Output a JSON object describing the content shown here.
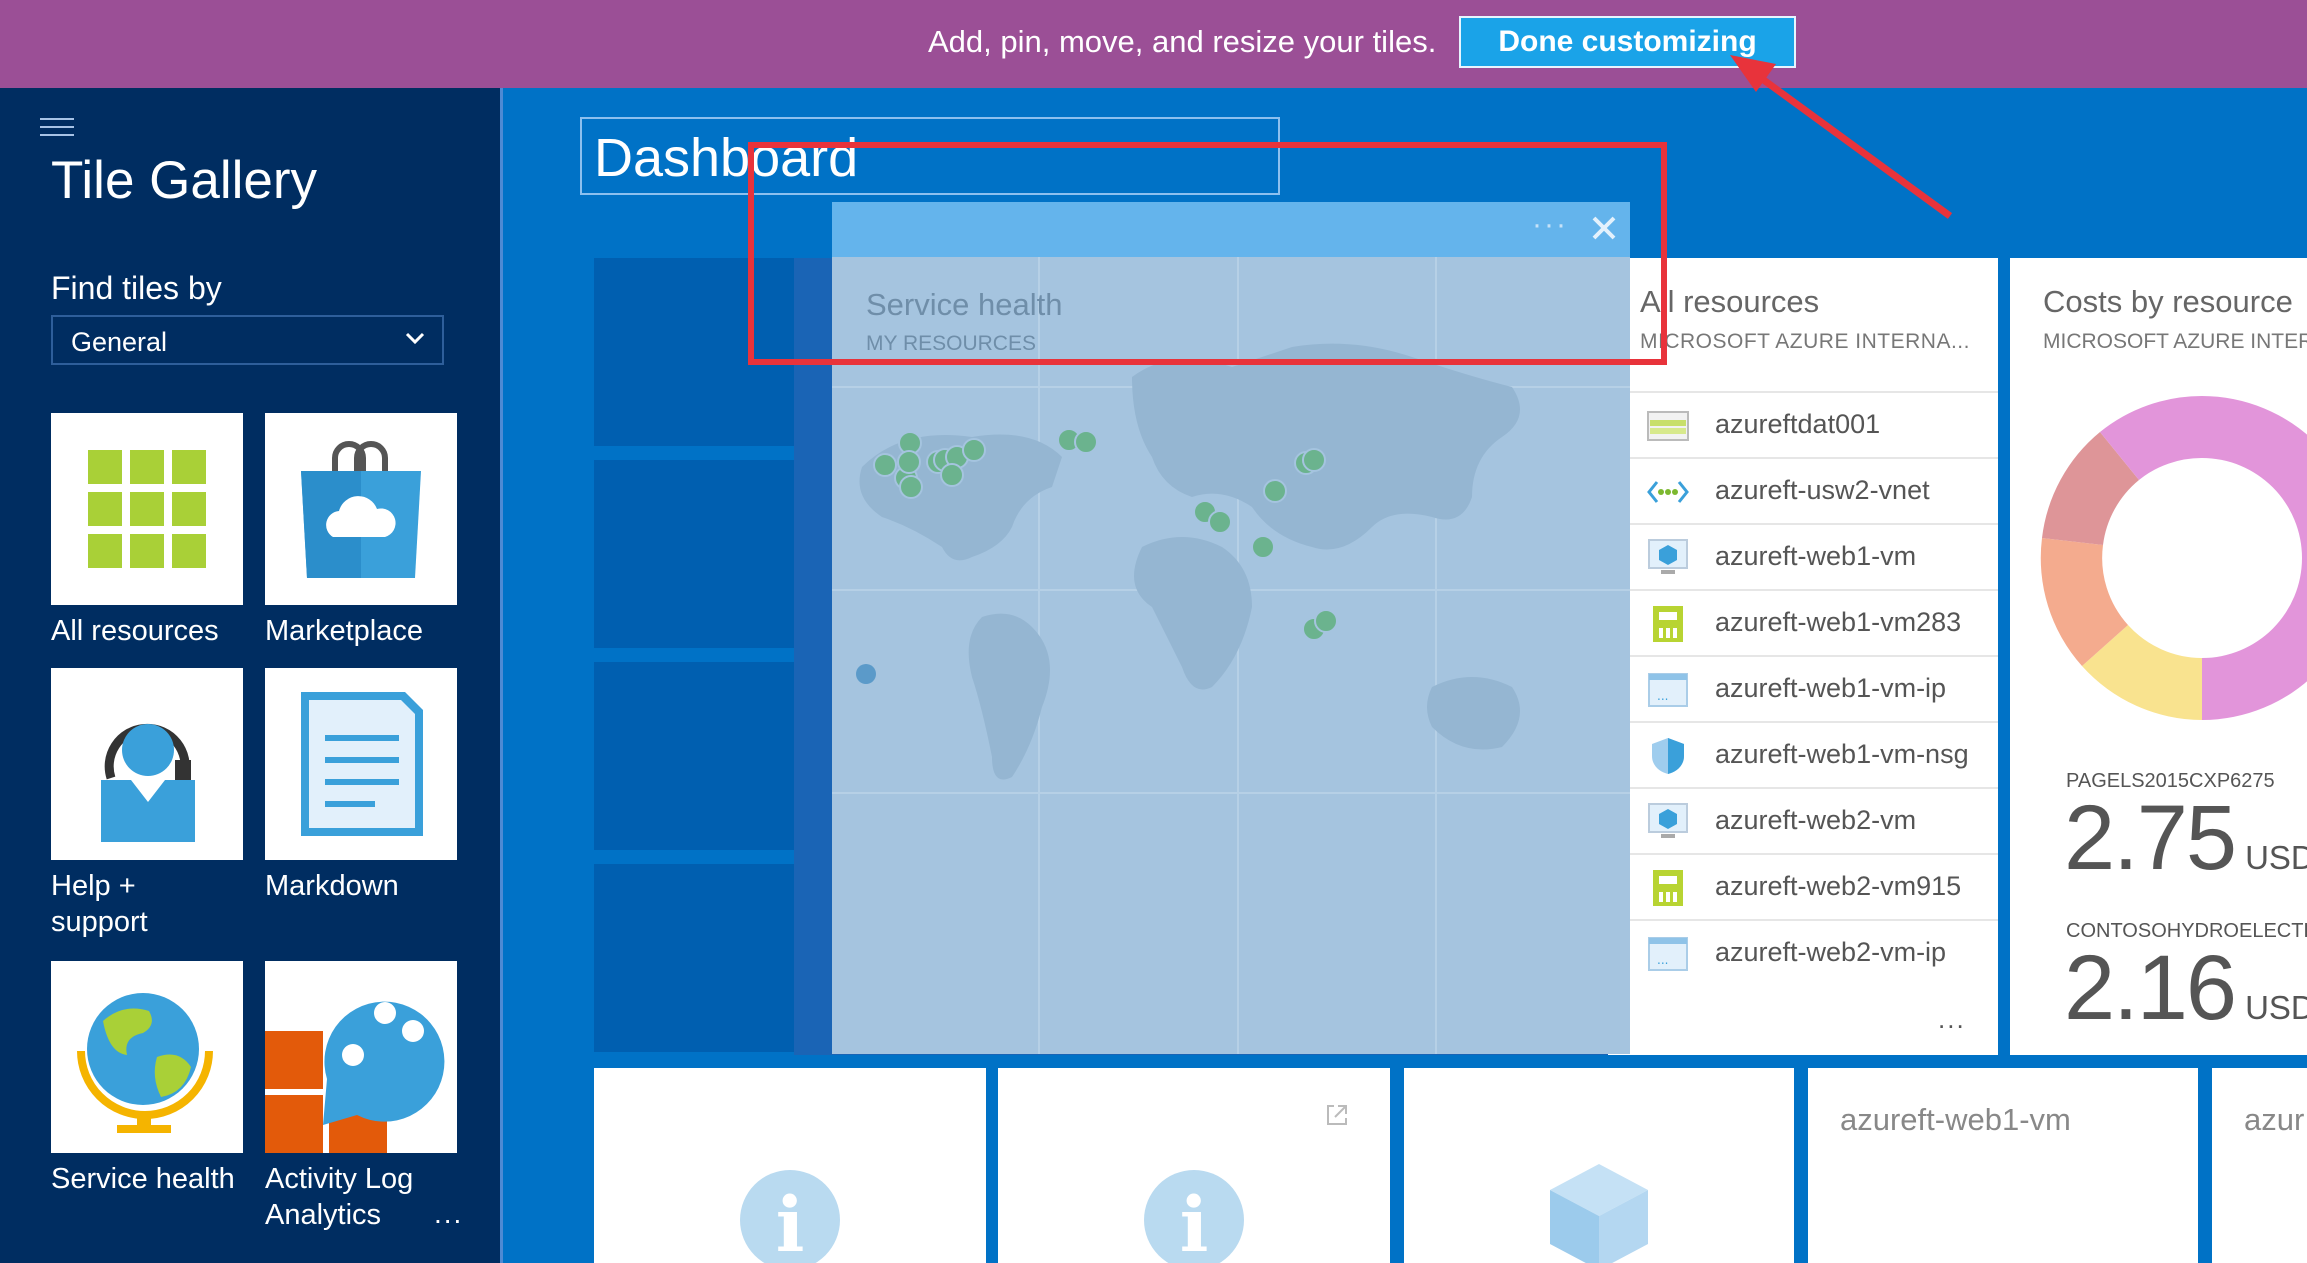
{
  "topbar": {
    "message": "Add, pin, move, and resize your tiles.",
    "done_label": "Done customizing",
    "bg_color": "#9b4f96",
    "button_color": "#1aa3e8"
  },
  "gallery": {
    "title": "Tile Gallery",
    "find_label": "Find tiles by",
    "filter_value": "General",
    "tiles": [
      {
        "label": "All resources",
        "icon": "grid-icon"
      },
      {
        "label": "Marketplace",
        "icon": "shopping-bag-icon"
      },
      {
        "label": "Help +\nsupport",
        "icon": "help-person-icon"
      },
      {
        "label": "Markdown",
        "icon": "document-icon"
      },
      {
        "label": "Service health",
        "icon": "globe-icon"
      },
      {
        "label": "Activity Log\nAnalytics",
        "icon": "activity-log-icon"
      }
    ],
    "more": "..."
  },
  "dashboard": {
    "title": "Dashboard",
    "service_health": {
      "title": "Service health",
      "subtitle": "MY RESOURCES",
      "menu": "···"
    },
    "all_resources": {
      "title": "All resources",
      "subtitle": "MICROSOFT AZURE INTERNA...",
      "items": [
        {
          "name": "azureftdat001",
          "icon": "storage-icon"
        },
        {
          "name": "azureft-usw2-vnet",
          "icon": "vnet-icon"
        },
        {
          "name": "azureft-web1-vm",
          "icon": "vm-icon"
        },
        {
          "name": "azureft-web1-vm283",
          "icon": "nic-icon"
        },
        {
          "name": "azureft-web1-vm-ip",
          "icon": "public-ip-icon"
        },
        {
          "name": "azureft-web1-vm-nsg",
          "icon": "nsg-shield-icon"
        },
        {
          "name": "azureft-web2-vm",
          "icon": "vm-icon"
        },
        {
          "name": "azureft-web2-vm915",
          "icon": "nic-icon"
        },
        {
          "name": "azureft-web2-vm-ip",
          "icon": "public-ip-icon"
        }
      ],
      "more": "..."
    },
    "costs": {
      "title": "Costs by resource",
      "subtitle": "MICROSOFT AZURE INTERNAL",
      "entries": [
        {
          "label": "PAGELS2015CXP6275",
          "value": "2.75",
          "currency": "USD"
        },
        {
          "label": "CONTOSOHYDROELECTRIC",
          "value": "2.16",
          "currency": "USD"
        }
      ],
      "donut_colors": [
        "#e295da",
        "#de9598",
        "#f4ab8e",
        "#f9e38f"
      ]
    },
    "bottom_tiles": [
      {
        "label": "",
        "icon": "info-icon"
      },
      {
        "label": "",
        "icon": "info-icon"
      },
      {
        "label": "",
        "icon": "cube-icon"
      },
      {
        "label": "azureft-web1-vm",
        "icon": ""
      },
      {
        "label": "azur",
        "icon": ""
      }
    ]
  },
  "annotation": {
    "highlight_color": "#e8333b"
  }
}
